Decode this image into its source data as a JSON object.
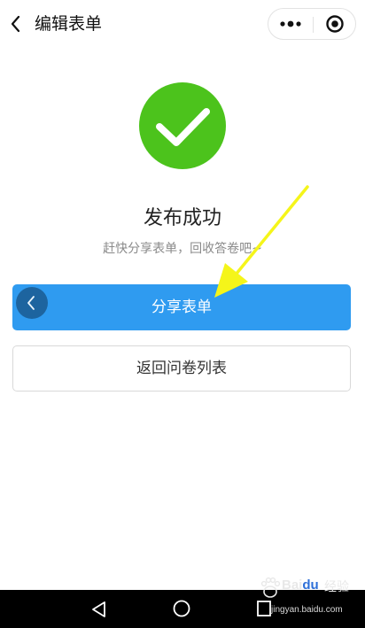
{
  "header": {
    "title": "编辑表单",
    "back_icon": "chevron-left-icon",
    "more_icon": "more-dots-icon",
    "close_icon": "target-circle-icon"
  },
  "status": {
    "icon": "checkmark-icon",
    "icon_color": "#4cc31c",
    "title": "发布成功",
    "subtitle": "赶快分享表单，回收答卷吧~"
  },
  "actions": {
    "share_label": "分享表单",
    "share_color": "#2f9bf0",
    "return_label": "返回问卷列表"
  },
  "annotation": {
    "arrow_color": "#f5f51a"
  },
  "navbar": {
    "back_icon": "triangle-back-icon",
    "home_icon": "circle-home-icon",
    "recent_icon": "square-recent-icon"
  },
  "watermark": {
    "brand_prefix": "Bai",
    "brand_suffix": "经验",
    "url": "jingyan.baidu.com"
  }
}
